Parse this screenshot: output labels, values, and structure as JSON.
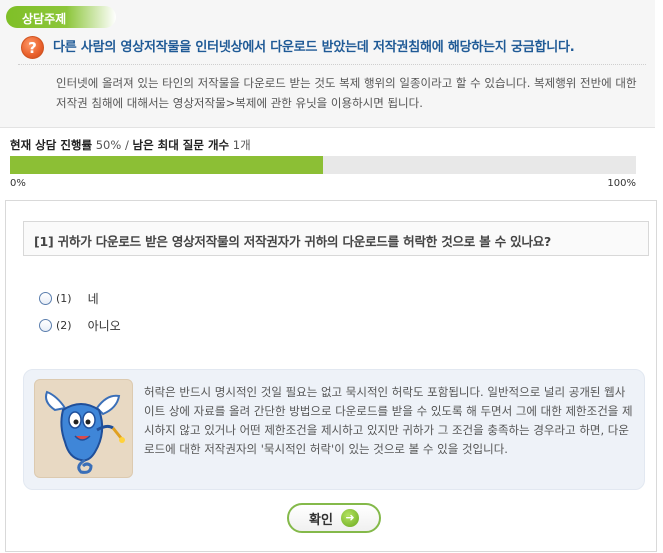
{
  "topic": {
    "tab_label": "상담주제",
    "icon": "question-icon",
    "question": "다른 사람의 영상저작물을 인터넷상에서 다운로드 받았는데 저작권침해에 해당하는지 궁금합니다.",
    "answer": "인터넷에 올려져 있는 타인의 저작물을 다운로드 받는 것도 복제 행위의 일종이라고 할 수 있습니다. 복제행위 전반에 대한 저작권 침해에 대해서는 영상저작물>복제에 관한 유닛을 이용하시면 됩니다."
  },
  "progress": {
    "label": "현재 상담 진행률",
    "percent_text": "50%",
    "separator": "/",
    "remaining_label": "남은 최대 질문 개수",
    "remaining_value": "1개",
    "fraction": 0.5,
    "min_label": "0%",
    "max_label": "100%",
    "fill_color": "#8cbf35"
  },
  "question": {
    "title": "[1] 귀하가 다운로드 받은 영상저작물의 저작권자가 귀하의 다운로드를 허락한 것으로 볼 수 있나요?",
    "options": [
      {
        "num": "(1)",
        "label": "네"
      },
      {
        "num": "(2)",
        "label": "아니오"
      }
    ]
  },
  "hint": {
    "image": "mascot-image",
    "text": "허락은 반드시 명시적인 것일 필요는 없고 묵시적인 허락도 포함됩니다. 일반적으로 널리 공개된 웹사이트 상에 자료를 올려 간단한 방법으로 다운로드를 받을 수 있도록 해 두면서 그에 대한 제한조건을 제시하지 않고 있거나 어떤 제한조건을 제시하고 있지만 귀하가 그 조건을 충족하는 경우라고 하면, 다운로드에 대한 저작권자의 '묵시적인 허락'이 있는 것으로 볼 수 있을 것입니다."
  },
  "confirm": {
    "label": "확인",
    "icon": "arrow-right-icon"
  }
}
